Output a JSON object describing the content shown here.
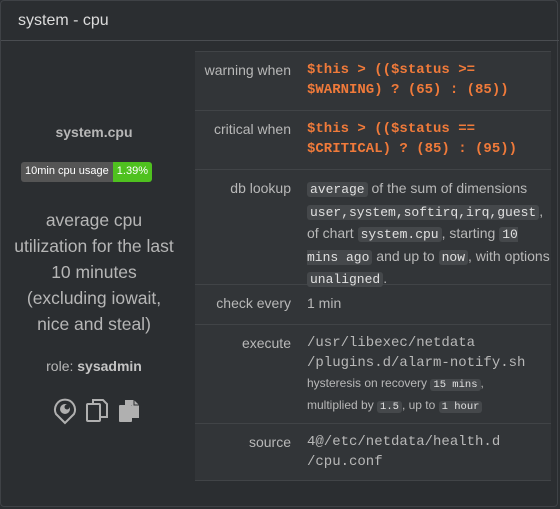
{
  "header": {
    "title": "system - cpu"
  },
  "sidebar": {
    "chart_name": "system.cpu",
    "badge": {
      "label": "10min cpu usage",
      "value": "1.39%"
    },
    "info_lines": [
      "average cpu",
      "utilization for the last",
      "10 minutes",
      "(excluding iowait,",
      "nice and steal)"
    ],
    "role_label": "role:",
    "role_value": "sysadmin",
    "icons": [
      "netdata-logo-icon",
      "copy-icon",
      "copy-all-icon"
    ]
  },
  "table": {
    "warning": {
      "key": "warning when",
      "line1": "$this > (($status >=",
      "line2": "$WARNING) ? (65) : (85))"
    },
    "critical": {
      "key": "critical when",
      "line1": "$this > (($status ==",
      "line2": "$CRITICAL) ? (85) : (95))"
    },
    "lookup": {
      "key": "db lookup",
      "method": "average",
      "t1": " of the sum of dimensions ",
      "dims": "user,system,softirq,irq,guest",
      "t2": ", of chart ",
      "chart": "system.cpu",
      "t3": ", starting ",
      "after": "10 mins ago",
      "t4": " and up to ",
      "before": "now",
      "t5": ", with options ",
      "options": "unaligned",
      "t6": "."
    },
    "every": {
      "key": "check every",
      "value": "1 min"
    },
    "exec": {
      "key": "execute",
      "line1": "/usr/libexec/netdata",
      "line2": "/plugins.d/alarm-notify.sh",
      "h1": "hysteresis on recovery ",
      "h1v": "15 mins",
      "h2": ",",
      "h3": "multiplied by ",
      "h3v": "1.5",
      "h4": ", up to ",
      "h4v": "1 hour"
    },
    "source": {
      "key": "source",
      "line1": "4@/etc/netdata/health.d",
      "line2": "/cpu.conf"
    }
  },
  "colors": {
    "accent_orange": "#f07a3a",
    "badge_green": "#4fc11f"
  }
}
